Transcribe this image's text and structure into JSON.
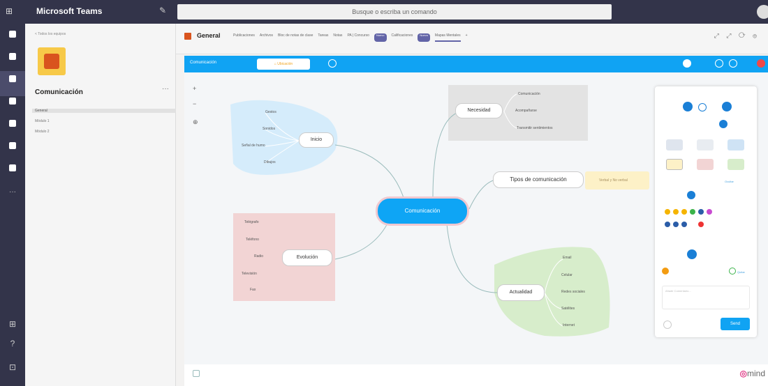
{
  "titlebar": {
    "app_title": "Microsoft Teams",
    "search_placeholder": "Busque o escriba un comando"
  },
  "left_panel": {
    "back_label": "< Todos los equipos",
    "team_name": "Comunicación",
    "more": "···",
    "channels": [
      "General",
      "Módulo 1",
      "Módulo 2"
    ]
  },
  "header": {
    "channel": "General",
    "tabs": [
      "Publicaciones",
      "Archivos",
      "Bloc de notas de clase",
      "Tareas",
      "Notas",
      "PA | Concurso",
      "Nuevo",
      "Calificaciones",
      "Nuevo",
      "Mapas Mentales"
    ],
    "active_tab": "Mapas Mentales",
    "right_icons": "⤢ ⤢ ⟳ ⊕"
  },
  "mindmap": {
    "toolbar": {
      "doc_title": "Comunicación",
      "button_label": "Ubicación"
    },
    "center": "Comunicación",
    "inicio": {
      "label": "Inicio",
      "items": [
        "Gestos",
        "Sonidos",
        "Señal de humo",
        "Dibujos"
      ]
    },
    "evolucion": {
      "label": "Evolución",
      "items": [
        "Telégrafo",
        "Teléfono",
        "Radio",
        "Televisión",
        "Fax"
      ]
    },
    "necesidad": {
      "label": "Necesidad",
      "items": [
        "Comunicación",
        "Acompañarse",
        "Transmitir sentimientos"
      ]
    },
    "tipos": {
      "label": "Tipos de comunicación",
      "sub": "Verbal y No verbal"
    },
    "actualidad": {
      "label": "Actualidad",
      "items": [
        "Email",
        "Celular",
        "Redes sociales",
        "Satélites",
        "Internet"
      ]
    },
    "footer_brand_suffix": "mind"
  },
  "panel": {
    "send_label": "Send",
    "link_label": "Condición",
    "text_placeholder": "Añadir Comentario...",
    "small_left": "Ocultar",
    "small_right": "Quitar"
  },
  "colors": {
    "teams_dark": "#33344a",
    "accent": "#6264a7",
    "mm_blue": "#10a3f3",
    "inicio_bg": "#d5ecfb",
    "evolucion_bg": "#f2d4d4",
    "necesidad_bg": "#e3e3e3",
    "actualidad_bg": "#d7edcb",
    "tipos_sub_bg": "#fdf1c7"
  }
}
